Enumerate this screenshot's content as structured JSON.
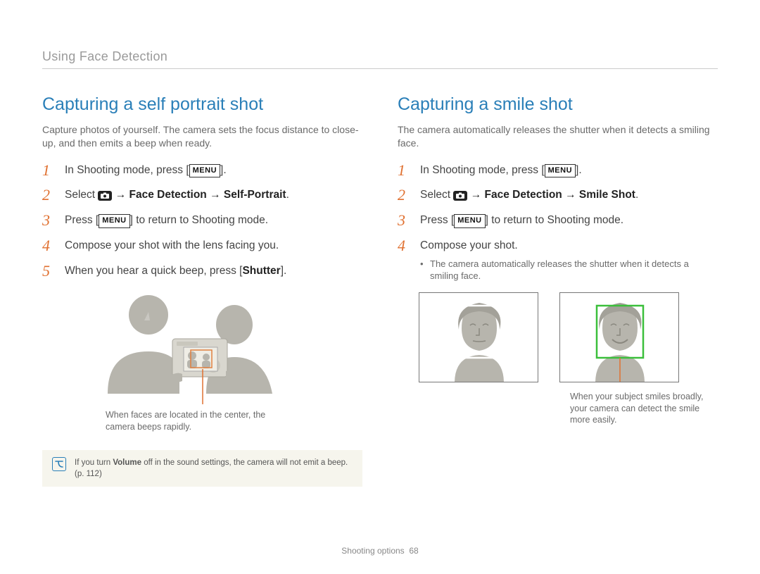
{
  "breadcrumb": "Using Face Detection",
  "left": {
    "heading": "Capturing a self portrait shot",
    "intro": "Capture photos of yourself. The camera sets the focus distance to close-up, and then emits a beep when ready.",
    "steps": {
      "s1_a": "In Shooting mode, press [",
      "s1_b": "].",
      "s2_a": "Select ",
      "s2_b": " → Face Detection → Self-Portrait",
      "s2_c": ".",
      "s3_a": "Press [",
      "s3_b": "] to return to Shooting mode.",
      "s4": "Compose your shot with the lens facing you.",
      "s5_a": "When you hear a quick beep, press [",
      "s5_b": "Shutter",
      "s5_c": "]."
    },
    "caption": "When faces are located in the center, the camera beeps rapidly.",
    "note_a": "If you turn ",
    "note_b": "Volume",
    "note_c": " off in the sound settings, the camera will not emit a beep. (p. 112)"
  },
  "right": {
    "heading": "Capturing a smile shot",
    "intro": "The camera automatically releases the shutter when it detects a smiling face.",
    "steps": {
      "s1_a": "In Shooting mode, press [",
      "s1_b": "].",
      "s2_a": "Select ",
      "s2_b": " → Face Detection → Smile Shot",
      "s2_c": ".",
      "s3_a": "Press [",
      "s3_b": "] to return to Shooting mode.",
      "s4": "Compose your shot.",
      "s4_sub": "The camera automatically releases the shutter when it detects a smiling face."
    },
    "caption": "When your subject smiles broadly, your camera can detect the smile more easily."
  },
  "menu_label": "MENU",
  "footer_section": "Shooting options",
  "footer_page": "68"
}
